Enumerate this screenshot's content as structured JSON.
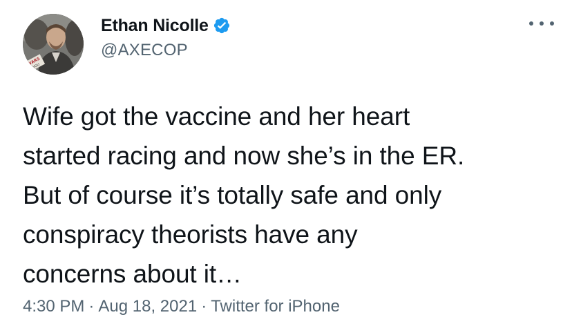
{
  "author": {
    "display_name": "Ethan Nicolle",
    "handle": "@AXECOP",
    "verified": true,
    "verified_icon": "verified-badge-icon",
    "avatar_icon": "profile-photo",
    "avatar_sign_text": "WARS\nL YOU"
  },
  "menu": {
    "icon": "more-horizontal-icon"
  },
  "tweet": {
    "text": "Wife got the vaccine and her heart\nstarted racing and now she’s in the ER.\nBut of course it’s totally safe and only\nconspiracy theorists have any\nconcerns about it…"
  },
  "meta": {
    "time": "4:30 PM",
    "separator": "·",
    "date": "Aug 18, 2021",
    "source": "Twitter for iPhone"
  },
  "colors": {
    "text_primary": "#0f1419",
    "text_secondary": "#536471",
    "verified_blue": "#1d9bf0",
    "background": "#ffffff"
  }
}
